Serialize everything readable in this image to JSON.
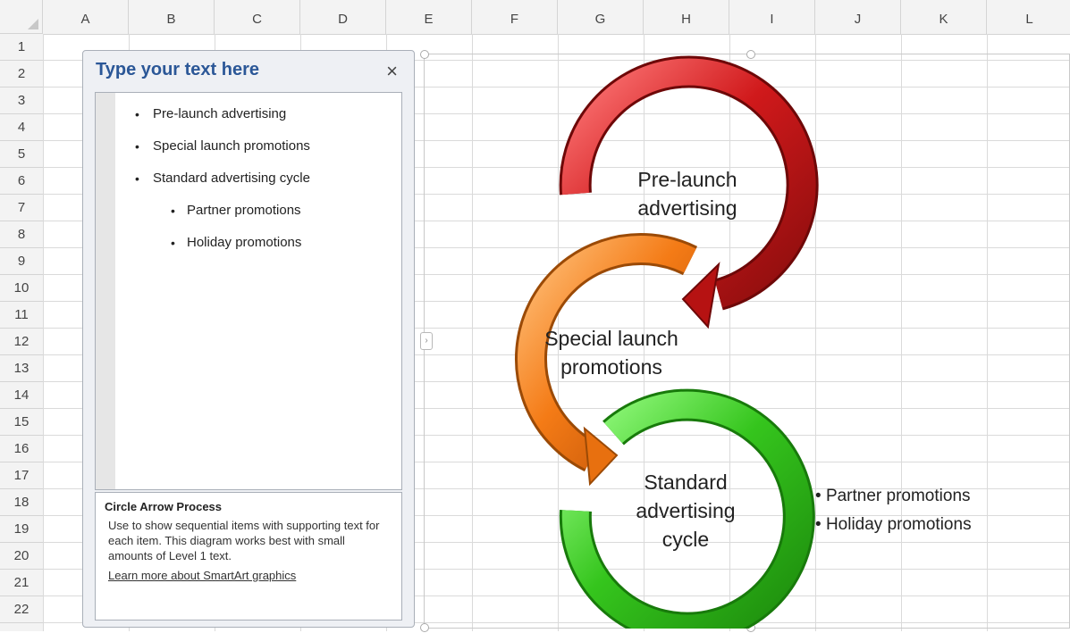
{
  "columns": [
    "A",
    "B",
    "C",
    "D",
    "E",
    "F",
    "G",
    "H",
    "I",
    "J",
    "K",
    "L"
  ],
  "rows": [
    "1",
    "2",
    "3",
    "4",
    "5",
    "6",
    "7",
    "8",
    "9",
    "10",
    "11",
    "12",
    "13",
    "14",
    "15",
    "16",
    "17",
    "18",
    "19",
    "20",
    "21",
    "22"
  ],
  "text_pane": {
    "title": "Type your text here",
    "close": "×",
    "bullets": [
      {
        "text": "Pre-launch advertising",
        "level": 1
      },
      {
        "text": "Special launch promotions",
        "level": 1
      },
      {
        "text": "Standard advertising cycle",
        "level": 1
      },
      {
        "text": "Partner promotions",
        "level": 2
      },
      {
        "text": "Holiday promotions",
        "level": 2
      }
    ],
    "description": {
      "title": "Circle Arrow Process",
      "text": "Use to show sequential items with supporting text for each item. This diagram works best with small amounts of Level 1 text.",
      "link": "Learn more about SmartArt graphics"
    }
  },
  "diagram": {
    "shapes": [
      {
        "line1": "Pre-launch",
        "line2": "advertising",
        "line3": "",
        "color": "#d0191b"
      },
      {
        "line1": "Special launch",
        "line2": "promotions",
        "line3": "",
        "color": "#f47b16"
      },
      {
        "line1": "Standard",
        "line2": "advertising",
        "line3": "cycle",
        "color": "#35c51d"
      }
    ],
    "child_bullets": [
      "Partner promotions",
      "Holiday promotions"
    ]
  },
  "icons": {
    "close": "close-icon",
    "expand": "chevron-right-icon"
  }
}
